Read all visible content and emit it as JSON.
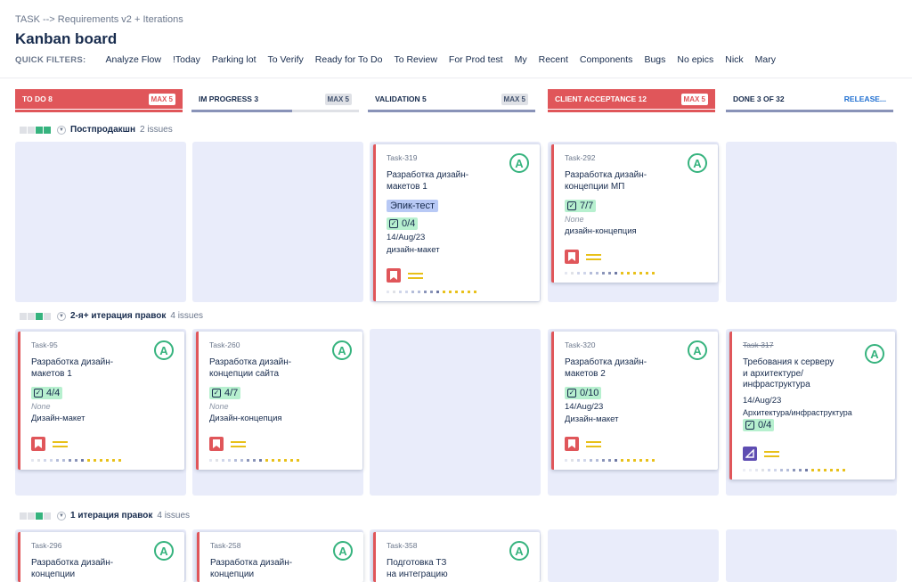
{
  "breadcrumb": "TASK --> Requirements v2 + Iterations",
  "title": "Kanban board",
  "quick_filters": {
    "label": "QUICK FILTERS:",
    "items": [
      "Analyze Flow",
      "!Today",
      "Parking lot",
      "To Verify",
      "Ready for To Do",
      "To Review",
      "For Prod test",
      "My",
      "Recent",
      "Components",
      "Bugs",
      "No epics",
      "Nick",
      "Mary"
    ]
  },
  "columns": [
    {
      "title": "TO DO 8",
      "badge": "MAX 5",
      "fill_fraction": 1.0,
      "style": "red"
    },
    {
      "title": "IM PROGRESS 3",
      "badge": "MAX 5",
      "fill_fraction": 0.6,
      "style": "plain"
    },
    {
      "title": "VALIDATION 5",
      "badge": "MAX 5",
      "fill_fraction": 1.0,
      "style": "plain"
    },
    {
      "title": "CLIENT ACCEPTANCE 12",
      "badge": "MAX 5",
      "fill_fraction": 1.0,
      "style": "red"
    },
    {
      "title": "DONE 3 OF 32",
      "badge": "RELEASE...",
      "fill_fraction": 1.0,
      "style": "plain"
    }
  ],
  "swimlanes": [
    {
      "title": "Постпродакшн",
      "count": "2 issues"
    },
    {
      "title": "2-я+ итерация правок",
      "count": "4 issues"
    },
    {
      "title": "1 итерация правок",
      "count": "4 issues"
    }
  ],
  "cards": {
    "c319": {
      "key": "Task-319",
      "avatar": "A",
      "summary_1": "Разработка дизайн-",
      "summary_2": "макетов 1",
      "epic": "Эпик-тест",
      "subtasks": "0/4",
      "date": "14/Aug/23",
      "component": "дизайн-макет"
    },
    "c292": {
      "key": "Task-292",
      "avatar": "A",
      "summary_1": "Разработка дизайн-",
      "summary_2": "концепции МП",
      "subtasks": "7/7",
      "none": "None",
      "component": "дизайн-концепция"
    },
    "c95": {
      "key": "Task-95",
      "avatar": "A",
      "summary_1": "Разработка дизайн-",
      "summary_2": "макетов 1",
      "subtasks": "4/4",
      "none": "None",
      "component": "Дизайн-макет"
    },
    "c260": {
      "key": "Task-260",
      "avatar": "A",
      "summary_1": "Разработка дизайн-",
      "summary_2": "концепции сайта",
      "subtasks": "4/7",
      "none": "None",
      "component": "Дизайн-концепция"
    },
    "c320": {
      "key": "Task-320",
      "avatar": "A",
      "summary_1": "Разработка дизайн-",
      "summary_2": "макетов 2",
      "subtasks": "0/10",
      "date": "14/Aug/23",
      "component": "Дизайн-макет"
    },
    "c317": {
      "key": "Task-317",
      "avatar": "A",
      "summary_1": "Требования к серверу",
      "summary_2": "и архитектуре/",
      "summary_3": "инфраструктура",
      "date": "14/Aug/23",
      "component": "Архитектура/инфраструктура",
      "subtasks": "0/4"
    },
    "c296": {
      "key": "Task-296",
      "avatar": "A",
      "summary_1": "Разработка дизайн-",
      "summary_2": "концепции"
    },
    "c258": {
      "key": "Task-258",
      "avatar": "A",
      "summary_1": "Разработка дизайн-",
      "summary_2": "концепции"
    },
    "c358": {
      "key": "Task-358",
      "avatar": "A",
      "summary_1": "Подготовка ТЗ",
      "summary_2": "на интеграцию"
    }
  },
  "icons": {
    "story": "story-icon",
    "bug": "bug-icon",
    "priority": "priority-medium-icon",
    "subtask": "checkbox-icon"
  },
  "colors": {
    "accent_red": "#e0565a",
    "lane_bg": "#e9ecfa",
    "avatar_green": "#36b37e",
    "priority_yellow": "#e8c019"
  }
}
